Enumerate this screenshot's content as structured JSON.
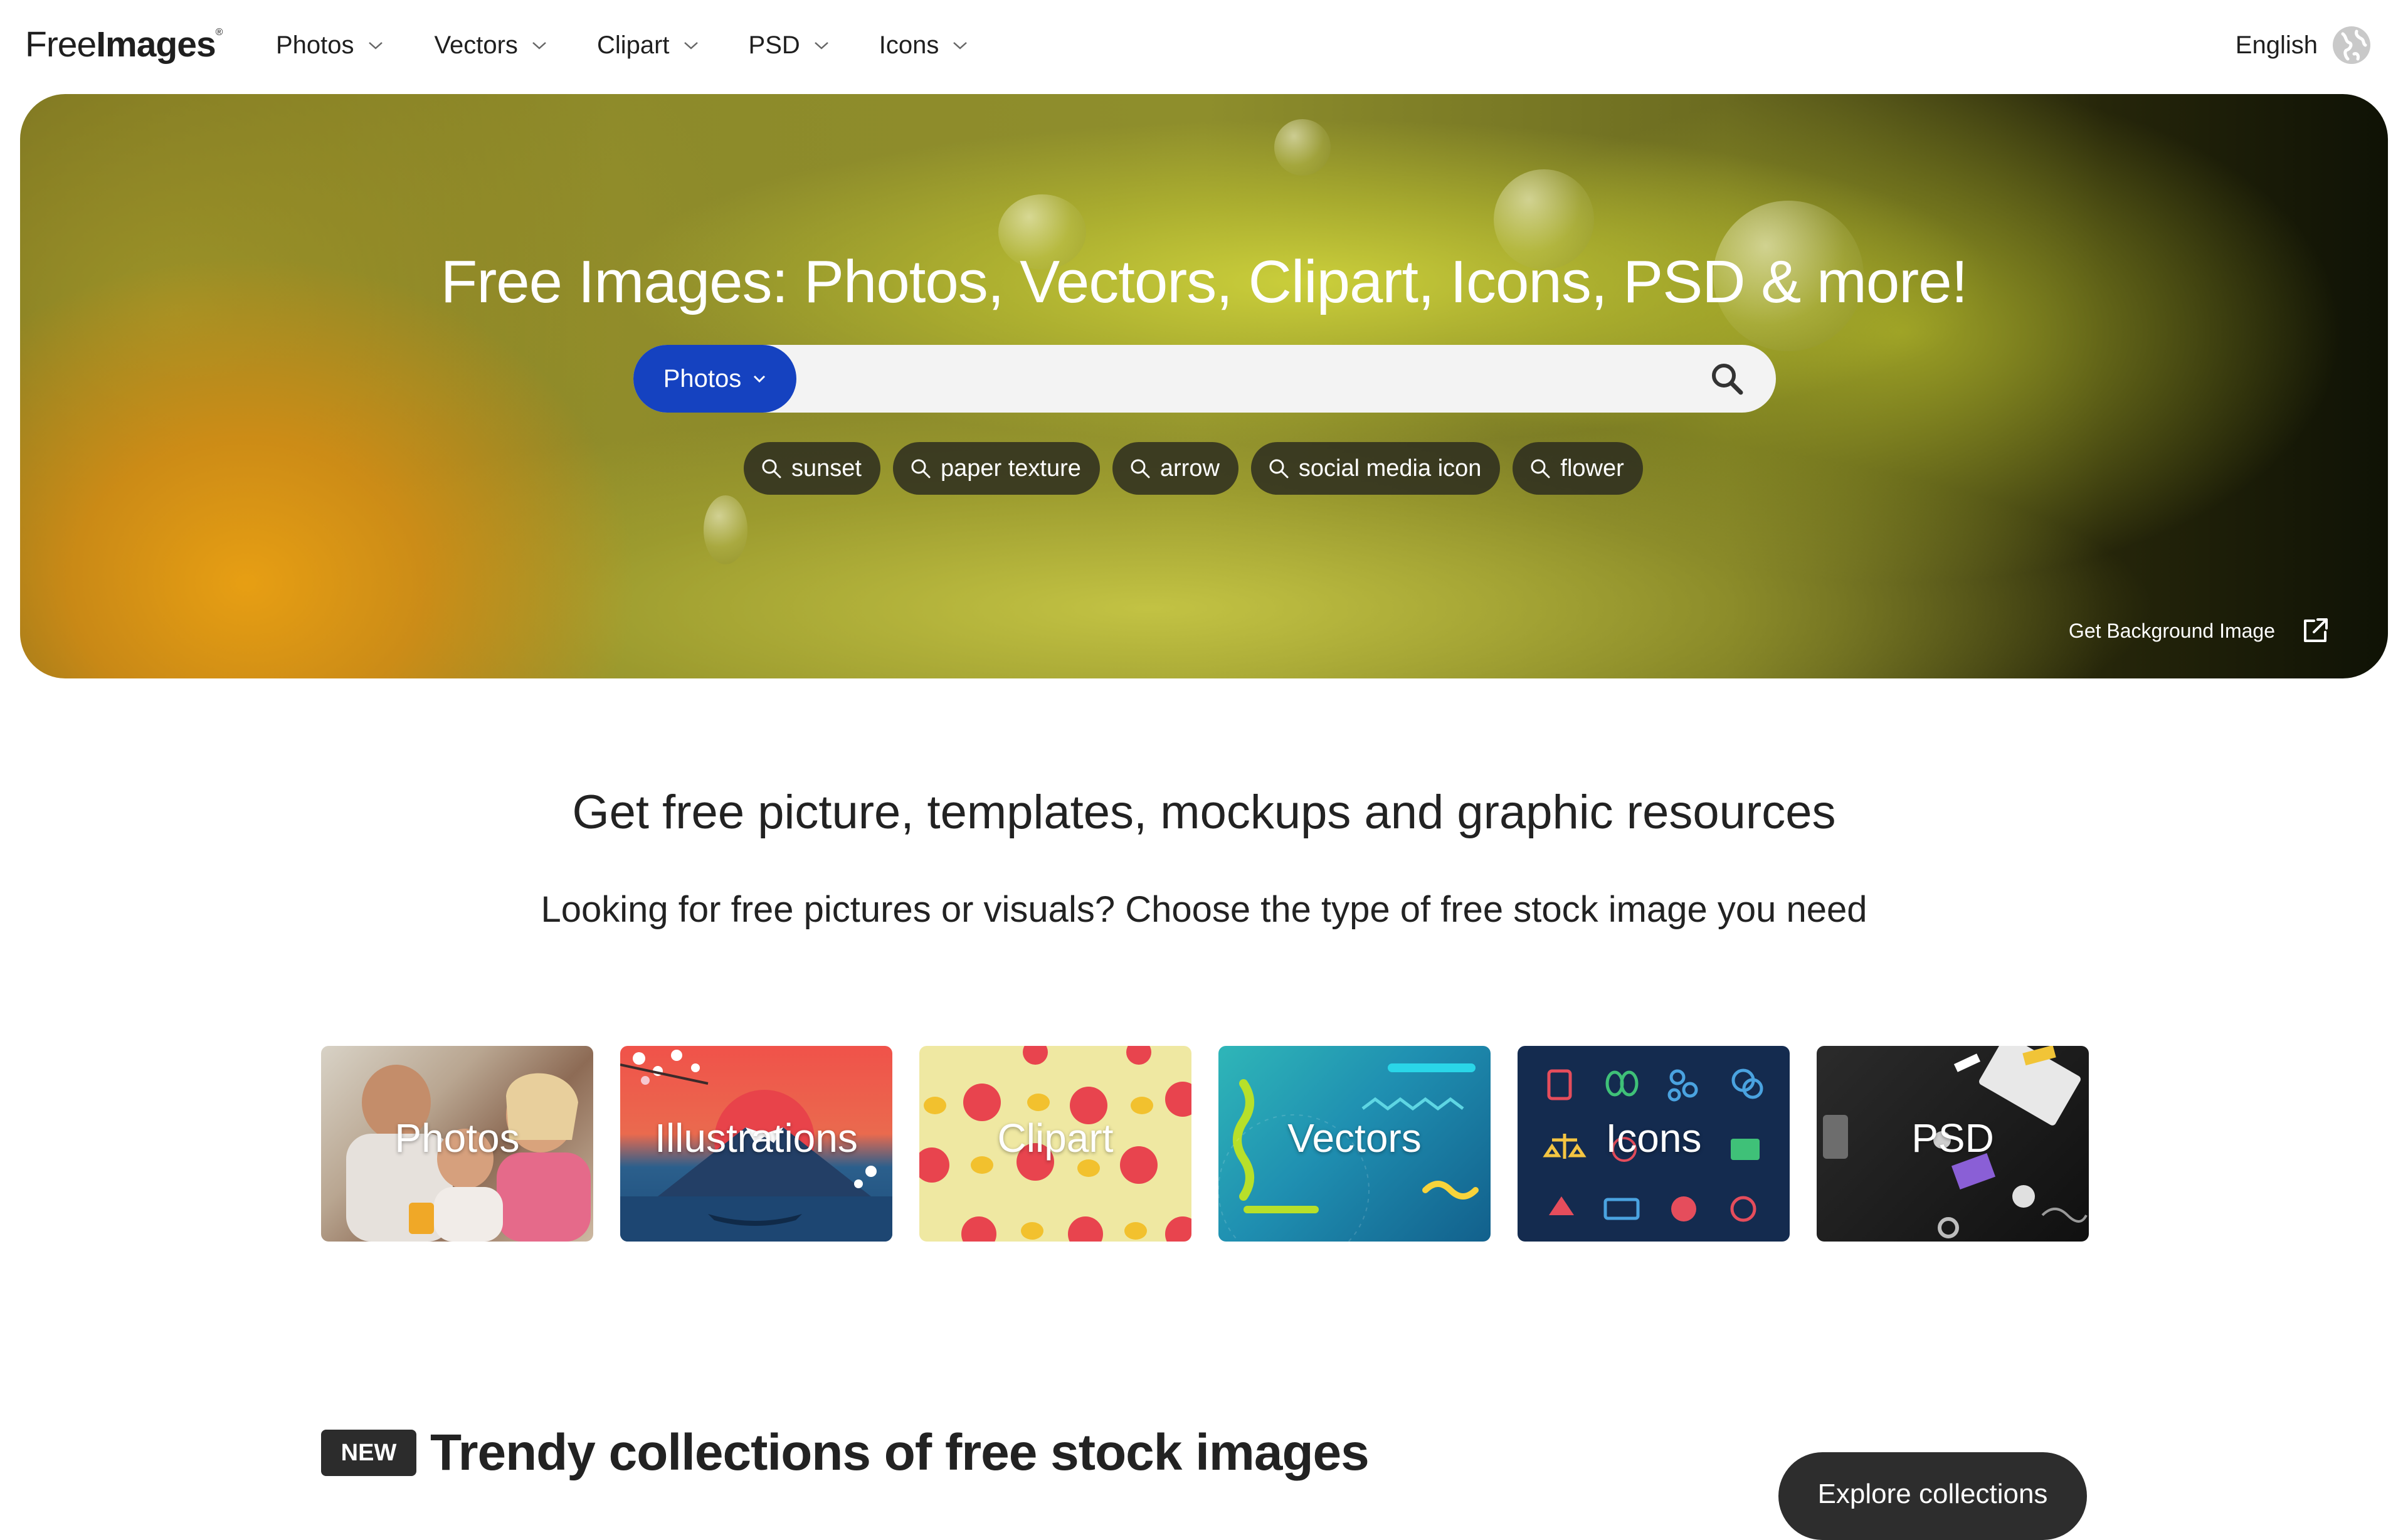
{
  "nav": {
    "logo_light": "Free",
    "logo_bold": "Images",
    "logo_mark": "®",
    "menu": [
      {
        "label": "Photos"
      },
      {
        "label": "Vectors"
      },
      {
        "label": "Clipart"
      },
      {
        "label": "PSD"
      },
      {
        "label": "Icons"
      }
    ],
    "language": "English"
  },
  "hero": {
    "title": "Free Images: Photos, Vectors, Clipart, Icons, PSD & more!",
    "search": {
      "type_label": "Photos",
      "value": "",
      "placeholder": ""
    },
    "tags": [
      {
        "label": "sunset"
      },
      {
        "label": "paper texture"
      },
      {
        "label": "arrow"
      },
      {
        "label": "social media icon"
      },
      {
        "label": "flower"
      }
    ],
    "background_link": "Get Background Image"
  },
  "intro": {
    "heading": "Get free picture, templates, mockups and graphic resources",
    "subheading": "Looking for free pictures or visuals? Choose the type of free stock image you need"
  },
  "categories": [
    {
      "label": "Photos"
    },
    {
      "label": "Illustrations"
    },
    {
      "label": "Clipart"
    },
    {
      "label": "Vectors"
    },
    {
      "label": "Icons"
    },
    {
      "label": "PSD"
    }
  ],
  "collections": {
    "badge": "NEW",
    "heading": "Trendy collections of free stock images",
    "button": "Explore collections"
  },
  "colors": {
    "accent_blue": "#1542c0",
    "dark": "#2c2c2c"
  }
}
